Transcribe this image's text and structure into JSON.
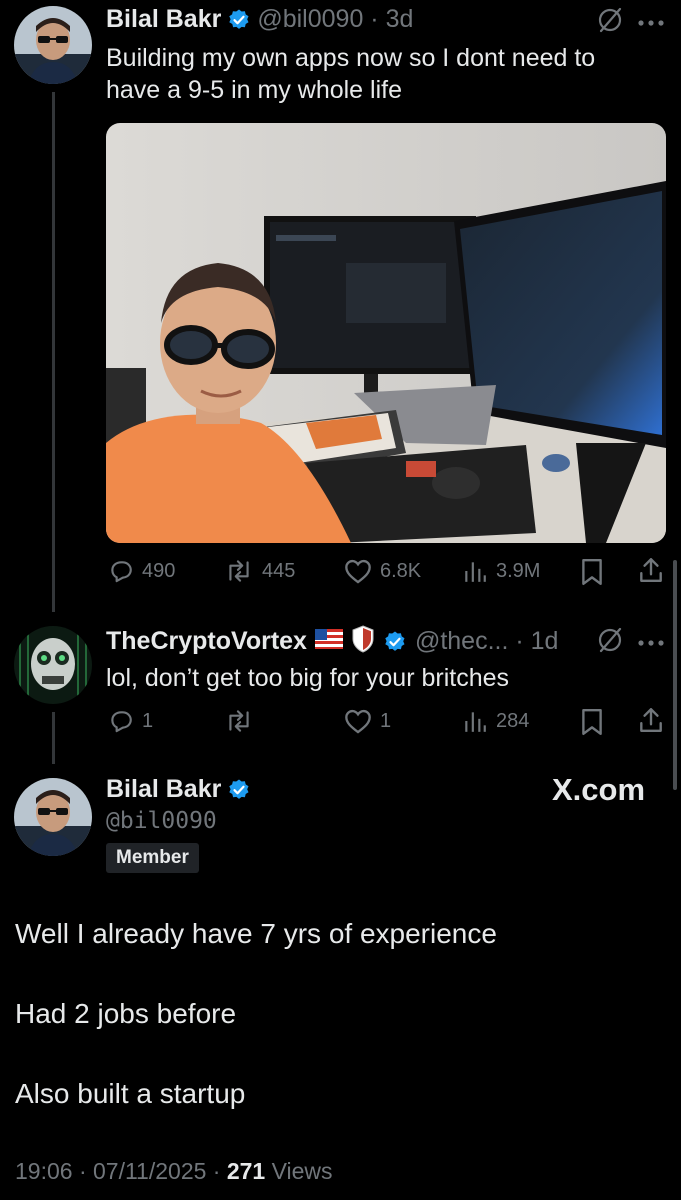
{
  "tweet1": {
    "name": "Bilal Bakr",
    "handle_time": "@bil0090 · 3d",
    "text": "Building my own apps now so I dont need to have a 9-5 in my whole life",
    "stats": {
      "replies": "490",
      "reposts": "445",
      "likes": "6.8K",
      "views": "3.9M"
    }
  },
  "reply": {
    "name": "TheCryptoVortex",
    "handle_time": "@thec... · 1d",
    "text": "lol, don’t get too big for your britches",
    "stats": {
      "replies": "1",
      "reposts": "",
      "likes": "1",
      "views": "284"
    }
  },
  "main": {
    "name": "Bilal Bakr",
    "handle": "@bil0090",
    "badge": "Member",
    "brand": "X.com",
    "lines": [
      "Well I already have 7 yrs of experience",
      "Had 2 jobs before",
      "Also built a startup"
    ],
    "time": "19:06 · 07/11/2025 · ",
    "views_count": "271",
    "views_label": " Views"
  },
  "colors": {
    "background": "#000000",
    "text": "#e7e9ea",
    "muted": "#71767b",
    "verified": "#1d9bf0"
  },
  "icons": [
    "verified-icon",
    "grok-icon",
    "more-icon",
    "reply-icon",
    "repost-icon",
    "like-icon",
    "views-icon",
    "bookmark-icon",
    "share-icon"
  ]
}
